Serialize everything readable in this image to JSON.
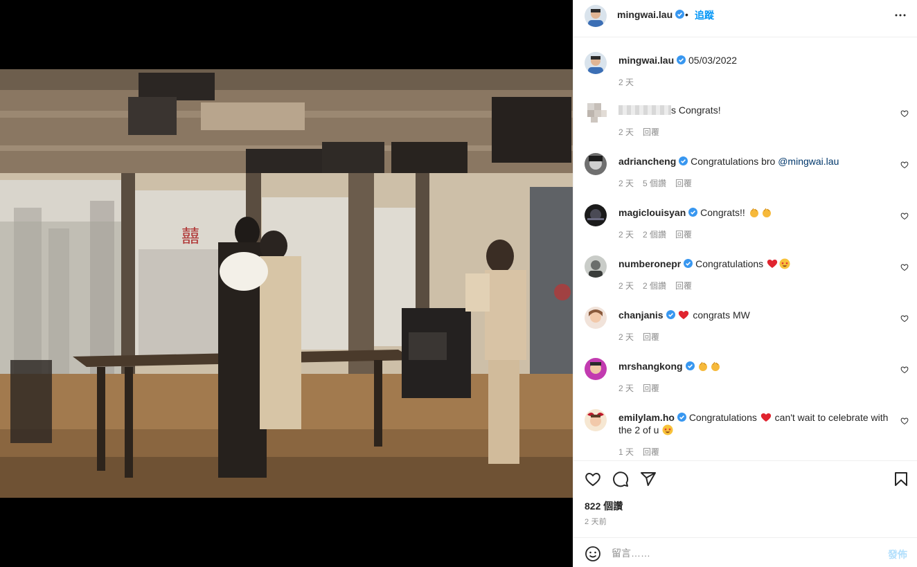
{
  "header": {
    "username": "mingwai.lau",
    "separator": "•",
    "follow_label": "追蹤"
  },
  "caption": {
    "username": "mingwai.lau",
    "text": "05/03/2022",
    "time": "2 天"
  },
  "comments": [
    {
      "username": "",
      "text": "s Congrats!",
      "time": "2 天",
      "likes": "",
      "reply": "回覆",
      "blurred": true
    },
    {
      "username": "adriancheng",
      "text": "Congratulations bro ",
      "mention": "@mingwai.lau",
      "time": "2 天",
      "likes": "5 個讚",
      "reply": "回覆"
    },
    {
      "username": "magiclouisyan",
      "text": "Congrats!! ",
      "emojis": [
        "clap",
        "clap"
      ],
      "time": "2 天",
      "likes": "2 個讚",
      "reply": "回覆"
    },
    {
      "username": "numberonepr",
      "text": "Congratulations ",
      "emojis": [
        "heart",
        "star-eyes"
      ],
      "time": "2 天",
      "likes": "2 個讚",
      "reply": "回覆"
    },
    {
      "username": "chanjanis",
      "text": "congrats MW",
      "emojis_before": [
        "heart"
      ],
      "time": "2 天",
      "likes": "",
      "reply": "回覆"
    },
    {
      "username": "mrshangkong",
      "text": "",
      "emojis": [
        "clap",
        "clap"
      ],
      "time": "2 天",
      "likes": "",
      "reply": "回覆"
    },
    {
      "username": "emilylam.ho",
      "text": "Congratulations ",
      "text2": " can't wait to celebrate with the 2 of u ",
      "emojis": [
        "heart"
      ],
      "emojis_end": [
        "star-eyes"
      ],
      "time": "1 天",
      "likes": "",
      "reply": "回覆"
    }
  ],
  "stats": {
    "likes": "822 個讚",
    "posted": "2 天前"
  },
  "compose": {
    "placeholder": "留言……",
    "post_label": "發佈"
  },
  "colors": {
    "accent": "#0095f6",
    "verified": "#3897f0",
    "heart_red": "#ed4956",
    "muted": "#8e8e8e"
  },
  "icons": [
    "more-icon",
    "heart-icon",
    "comment-icon",
    "share-icon",
    "bookmark-icon",
    "emoji-icon",
    "verified-icon"
  ]
}
